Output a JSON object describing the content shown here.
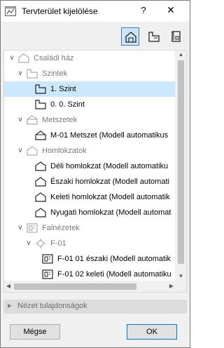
{
  "window": {
    "title": "Tervterület kijelölése",
    "help_label": "?",
    "close_label": "✕"
  },
  "toolbar": {
    "buttons": [
      "project-map-icon",
      "view-map-icon",
      "layout-book-icon"
    ]
  },
  "tree": {
    "rows": [
      {
        "label": "Családi ház",
        "greyed": true,
        "icon": "house-icon"
      },
      {
        "label": "Szintek",
        "greyed": true,
        "icon": "stories-icon"
      },
      {
        "label": "1. Szint",
        "greyed": false,
        "icon": "story-icon",
        "selected": true
      },
      {
        "label": "0. 0. Szint",
        "greyed": false,
        "icon": "story-icon"
      },
      {
        "label": "Metszetek",
        "greyed": true,
        "icon": "section-folder-icon"
      },
      {
        "label": "M-01 Metszet (Modell automatikus",
        "greyed": false,
        "icon": "section-icon"
      },
      {
        "label": "Homlokzatok",
        "greyed": true,
        "icon": "elevation-folder-icon"
      },
      {
        "label": "Déli homlokzat (Modell automatiku",
        "greyed": false,
        "icon": "elevation-icon"
      },
      {
        "label": "Északi homlokzat (Modell automati",
        "greyed": false,
        "icon": "elevation-icon"
      },
      {
        "label": "Keleti homlokzat (Modell automatik",
        "greyed": false,
        "icon": "elevation-icon"
      },
      {
        "label": "Nyugati homlokzat (Modell automat",
        "greyed": false,
        "icon": "elevation-icon"
      },
      {
        "label": "Falnézetek",
        "greyed": true,
        "icon": "interior-elevation-folder-icon"
      },
      {
        "label": "F-01",
        "greyed": true,
        "icon": "marker-icon"
      },
      {
        "label": "F-01 01 északi (Modell automatik",
        "greyed": false,
        "icon": "interior-elevation-icon"
      },
      {
        "label": "F-01 02 keleti (Modell automatiku",
        "greyed": false,
        "icon": "interior-elevation-icon"
      }
    ]
  },
  "properties": {
    "label": "Nézet tulajdonságok"
  },
  "buttons": {
    "cancel": "Mégse",
    "ok": "OK"
  },
  "colors": {
    "selection": "#cce8ff",
    "accent": "#0078d7",
    "greyed_text": "#7a7a7a"
  }
}
